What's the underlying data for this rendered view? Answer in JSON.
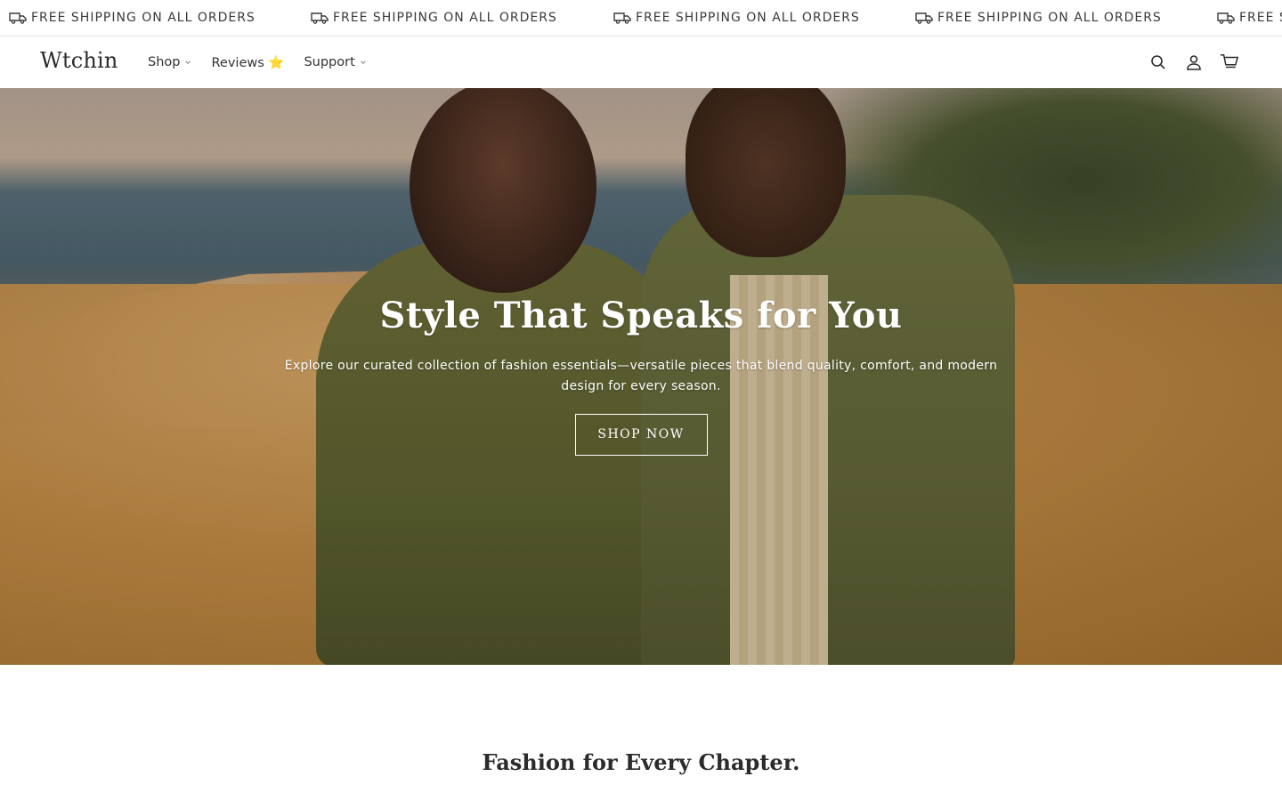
{
  "announcement": {
    "text": "FREE SHIPPING ON ALL ORDERS",
    "icon": "truck-icon"
  },
  "header": {
    "logo": "Wtchin",
    "nav": [
      {
        "label": "Shop",
        "has_dropdown": true
      },
      {
        "label": "Reviews ⭐",
        "has_dropdown": false
      },
      {
        "label": "Support",
        "has_dropdown": true
      }
    ],
    "icons": [
      "search-icon",
      "account-icon",
      "cart-icon"
    ]
  },
  "hero": {
    "title": "Style That Speaks for You",
    "text": "Explore our curated collection of fashion essentials—versatile pieces that blend quality, comfort, and modern design for every season.",
    "button_label": "SHOP NOW"
  },
  "section": {
    "title": "Fashion for Every Chapter."
  },
  "colors": {
    "text": "#1f1f1f",
    "border": "#e6e6e6",
    "hero_overlay_text": "#ffffff"
  }
}
